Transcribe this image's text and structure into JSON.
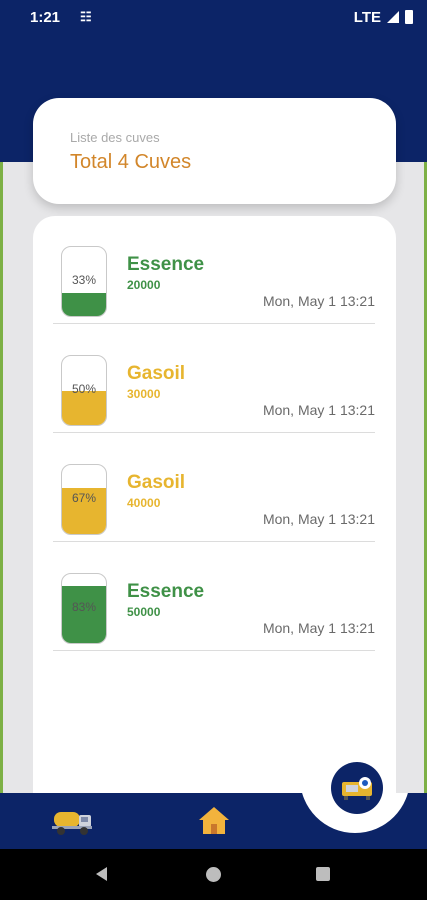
{
  "status_bar": {
    "time": "1:21",
    "network": "LTE"
  },
  "summary": {
    "subtitle": "Liste des cuves",
    "title": "Total 4 Cuves"
  },
  "tanks": [
    {
      "name": "Essence",
      "quantity": "20000",
      "percent_label": "33%",
      "fill_level": 0.33,
      "date": "Mon, May 1 13:21",
      "color": "#3f9147"
    },
    {
      "name": "Gasoil",
      "quantity": "30000",
      "percent_label": "50%",
      "fill_level": 0.5,
      "date": "Mon, May 1 13:21",
      "color": "#e7b52f"
    },
    {
      "name": "Gasoil",
      "quantity": "40000",
      "percent_label": "67%",
      "fill_level": 0.67,
      "date": "Mon, May 1 13:21",
      "color": "#e7b52f"
    },
    {
      "name": "Essence",
      "quantity": "50000",
      "percent_label": "83%",
      "fill_level": 0.83,
      "date": "Mon, May 1 13:21",
      "color": "#3f9147"
    }
  ],
  "bottom_nav": {
    "items": [
      "truck-icon",
      "home-icon"
    ]
  },
  "fab": {
    "icon": "generator-icon"
  },
  "colors": {
    "primary": "#0c2467",
    "accent_orange": "#d2862a",
    "green": "#3f9147",
    "yellow": "#e7b52f"
  }
}
